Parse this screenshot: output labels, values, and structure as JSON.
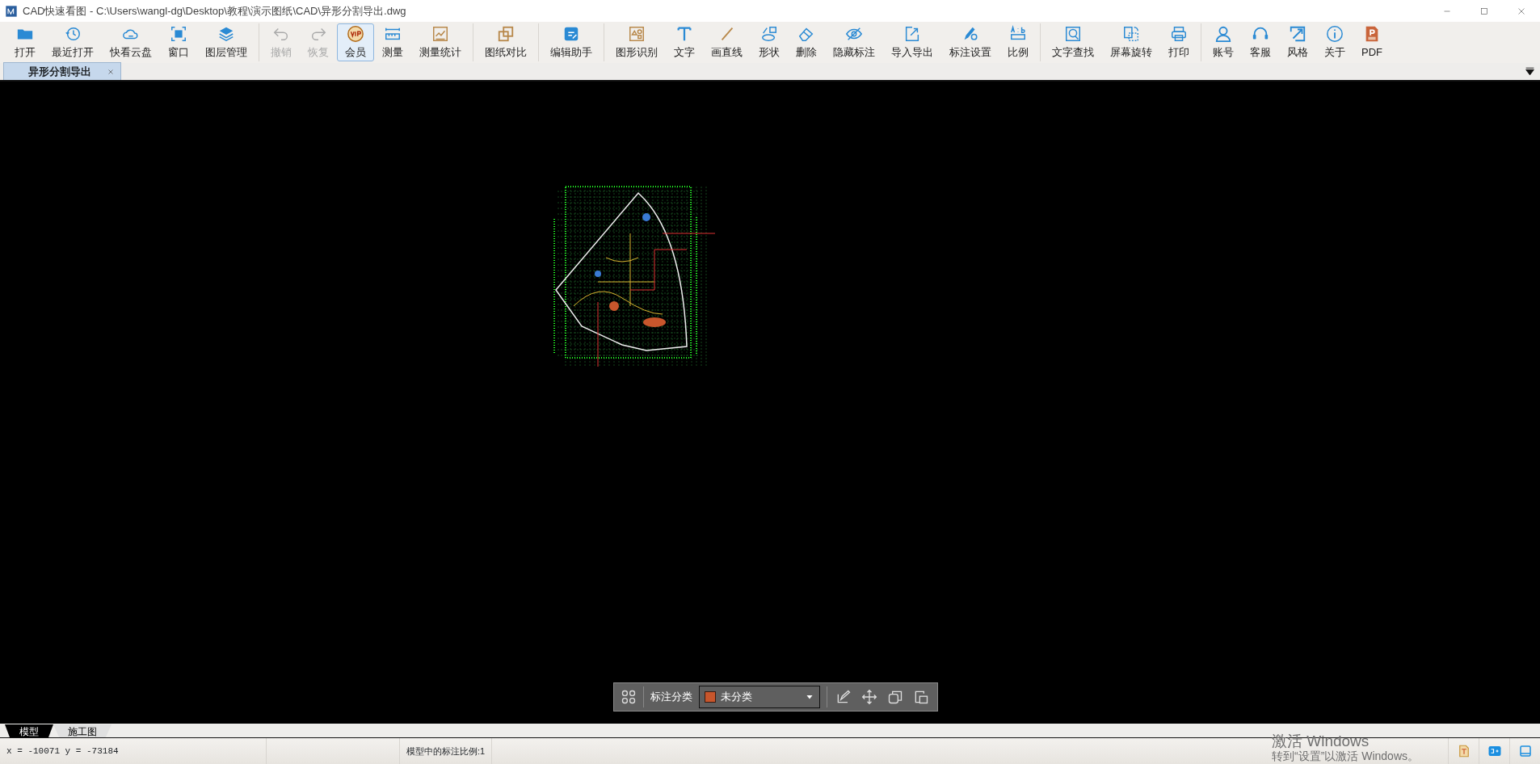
{
  "window": {
    "title": "CAD快速看图 - C:\\Users\\wangl-dg\\Desktop\\教程\\演示图纸\\CAD\\异形分割导出.dwg"
  },
  "toolbar": {
    "groups": [
      [
        {
          "label": "打开",
          "disabled": false,
          "selected": false
        },
        {
          "label": "最近打开",
          "disabled": false,
          "selected": false
        },
        {
          "label": "快看云盘",
          "disabled": false,
          "selected": false
        },
        {
          "label": "窗口",
          "disabled": false,
          "selected": false
        },
        {
          "label": "图层管理",
          "disabled": false,
          "selected": false
        }
      ],
      [
        {
          "label": "撤销",
          "disabled": true,
          "selected": false
        },
        {
          "label": "恢复",
          "disabled": true,
          "selected": false
        },
        {
          "label": "会员",
          "disabled": false,
          "selected": true
        },
        {
          "label": "测量",
          "disabled": false,
          "selected": false
        },
        {
          "label": "测量统计",
          "disabled": false,
          "selected": false
        }
      ],
      [
        {
          "label": "图纸对比",
          "disabled": false,
          "selected": false
        }
      ],
      [
        {
          "label": "编辑助手",
          "disabled": false,
          "selected": false
        }
      ],
      [
        {
          "label": "图形识别",
          "disabled": false,
          "selected": false
        },
        {
          "label": "文字",
          "disabled": false,
          "selected": false
        },
        {
          "label": "画直线",
          "disabled": false,
          "selected": false
        },
        {
          "label": "形状",
          "disabled": false,
          "selected": false
        },
        {
          "label": "删除",
          "disabled": false,
          "selected": false
        },
        {
          "label": "隐藏标注",
          "disabled": false,
          "selected": false
        },
        {
          "label": "导入导出",
          "disabled": false,
          "selected": false
        },
        {
          "label": "标注设置",
          "disabled": false,
          "selected": false
        },
        {
          "label": "比例",
          "disabled": false,
          "selected": false
        }
      ],
      [
        {
          "label": "文字查找",
          "disabled": false,
          "selected": false
        },
        {
          "label": "屏幕旋转",
          "disabled": false,
          "selected": false
        },
        {
          "label": "打印",
          "disabled": false,
          "selected": false
        }
      ],
      [
        {
          "label": "账号",
          "disabled": false,
          "selected": false
        },
        {
          "label": "客服",
          "disabled": false,
          "selected": false
        },
        {
          "label": "风格",
          "disabled": false,
          "selected": false
        },
        {
          "label": "关于",
          "disabled": false,
          "selected": false
        },
        {
          "label": "PDF",
          "disabled": false,
          "selected": false
        }
      ]
    ]
  },
  "document_tabs": [
    {
      "label": "异形分割导出",
      "selected": true
    }
  ],
  "annotation_bar": {
    "label": "标注分类",
    "category": {
      "label": "未分类",
      "color": "#c8562c"
    }
  },
  "layout_tabs": [
    {
      "label": "模型",
      "selected": true
    },
    {
      "label": "施工图",
      "selected": false
    }
  ],
  "status_bar": {
    "coordinates": "x = -10071 y = -73184",
    "scale": "模型中的标注比例:1"
  },
  "activation_notice": {
    "title": "激活 Windows",
    "message": "转到“设置”以激活 Windows。"
  }
}
